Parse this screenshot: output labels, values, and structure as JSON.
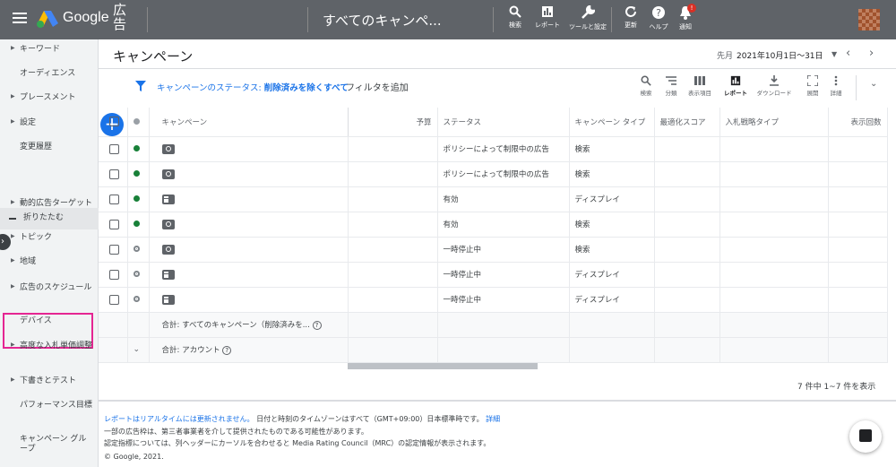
{
  "topbar": {
    "brand": "Google",
    "brand_suffix": "広告",
    "crumb": "すべてのキャンペ...",
    "badge": "!",
    "tools": [
      {
        "label": "検索",
        "icon": "search-icon"
      },
      {
        "label": "レポート",
        "icon": "report-icon"
      },
      {
        "label": "ツールと設定",
        "icon": "wrench-icon"
      },
      {
        "label": "更新",
        "icon": "refresh-icon"
      },
      {
        "label": "ヘルプ",
        "icon": "help-icon"
      },
      {
        "label": "通知",
        "icon": "bell-icon"
      }
    ]
  },
  "sidebar": {
    "items": [
      {
        "label": "キーワード",
        "caret": true
      },
      {
        "label": "オーディエンス",
        "caret": false
      },
      {
        "label": "プレースメント",
        "caret": true
      },
      {
        "label": "設定",
        "caret": true
      },
      {
        "label": "変更履歴",
        "caret": false
      },
      {
        "label": "折りたたむ",
        "caret": false
      },
      {
        "label": "動的広告ターゲット",
        "caret": true
      },
      {
        "label": "トピック",
        "caret": true
      },
      {
        "label": "地域",
        "caret": true
      },
      {
        "label": "広告のスケジュール",
        "caret": true
      },
      {
        "label": "デバイス",
        "caret": false
      },
      {
        "label": "高度な入札単価調整",
        "caret": true
      },
      {
        "label": "下書きとテスト",
        "caret": true
      },
      {
        "label": "パフォーマンス目標",
        "caret": false
      },
      {
        "label": "キャンペーン グループ",
        "caret": false
      }
    ]
  },
  "page": {
    "title": "キャンペーン",
    "range_label": "先月",
    "range_value": "2021年10月1日～31日"
  },
  "filter": {
    "prefix": "キャンペーンのステータス: ",
    "value": "削除済みを除くすべて",
    "add": "フィルタを追加"
  },
  "toolbar": [
    {
      "label": "検索",
      "icon": "search-icon"
    },
    {
      "label": "分類",
      "icon": "segment-icon"
    },
    {
      "label": "表示項目",
      "icon": "columns-icon"
    },
    {
      "label": "レポート",
      "icon": "report-icon",
      "active": true
    },
    {
      "label": "ダウンロード",
      "icon": "download-icon"
    },
    {
      "label": "展開",
      "icon": "expand-icon"
    },
    {
      "label": "詳細",
      "icon": "more-icon"
    }
  ],
  "table": {
    "headers": [
      "キャンペーン",
      "予算",
      "ステータス",
      "キャンペーン タイプ",
      "最適化スコア",
      "入札戦略タイプ",
      "表示回数"
    ],
    "rows": [
      {
        "state": "enabled",
        "type_icon": "search",
        "status": "ポリシーによって制限中の広告",
        "ctype": "検索"
      },
      {
        "state": "enabled",
        "type_icon": "search",
        "status": "ポリシーによって制限中の広告",
        "ctype": "検索"
      },
      {
        "state": "enabled",
        "type_icon": "display",
        "status": "有効",
        "ctype": "ディスプレイ"
      },
      {
        "state": "enabled",
        "type_icon": "search",
        "status": "有効",
        "ctype": "検索"
      },
      {
        "state": "paused",
        "type_icon": "search",
        "status": "一時停止中",
        "ctype": "検索"
      },
      {
        "state": "paused",
        "type_icon": "display",
        "status": "一時停止中",
        "ctype": "ディスプレイ"
      },
      {
        "state": "paused",
        "type_icon": "display",
        "status": "一時停止中",
        "ctype": "ディスプレイ"
      }
    ],
    "total_all": "合計: すべてのキャンペーン（削除済みを...",
    "total_account": "合計: アカウント"
  },
  "pagination": "7 件中 1~7 件を表示",
  "footer": {
    "line1_link": "レポートはリアルタイムには更新されません。",
    "line1_rest": "日付と時刻のタイムゾーンはすべて（GMT+09:00）日本標準時です。",
    "line1_detail": "詳細",
    "line2": "一部の広告枠は、第三者事業者を介して提供されたものである可能性があります。",
    "line3": "認定指標については、列ヘッダーにカーソルを合わせると Media Rating Council（MRC）の認定情報が表示されます。",
    "copyright": "© Google, 2021."
  },
  "colors": {
    "topbar": "#5f6368",
    "accent": "#1a73e8",
    "enabled": "#188038",
    "highlight": "#e52592"
  }
}
